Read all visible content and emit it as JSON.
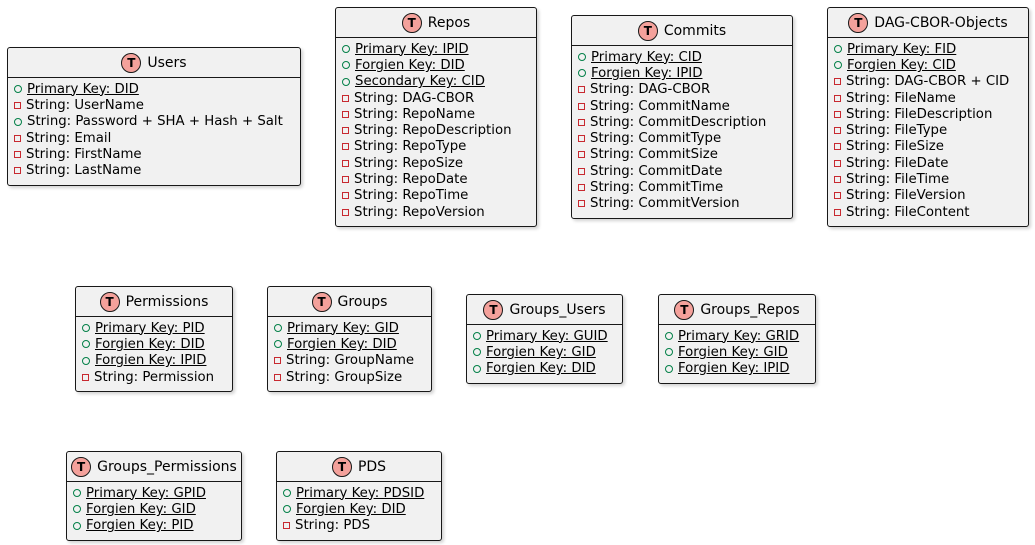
{
  "badge_letter": "T",
  "colors": {
    "badge_fill": "#f4a19b",
    "public": "#038048",
    "private": "#c82930",
    "box_fill": "#f1f1f1",
    "border": "#181818"
  },
  "entities": [
    {
      "id": "users",
      "title": "Users",
      "rows": [
        {
          "text": "Primary Key: DID",
          "vis": "public",
          "underline": true
        },
        {
          "text": "String: UserName",
          "vis": "private",
          "underline": false
        },
        {
          "text": "String: Password + SHA + Hash + Salt",
          "vis": "public",
          "underline": false
        },
        {
          "text": "String: Email",
          "vis": "private",
          "underline": false
        },
        {
          "text": "String: FirstName",
          "vis": "private",
          "underline": false
        },
        {
          "text": "String: LastName",
          "vis": "private",
          "underline": false
        }
      ]
    },
    {
      "id": "repos",
      "title": "Repos",
      "rows": [
        {
          "text": "Primary Key: IPID",
          "vis": "public",
          "underline": true
        },
        {
          "text": "Forgien Key: DID",
          "vis": "public",
          "underline": true
        },
        {
          "text": "Secondary Key: CID ",
          "vis": "public",
          "underline": true
        },
        {
          "text": "String: DAG-CBOR",
          "vis": "private",
          "underline": false
        },
        {
          "text": "String: RepoName",
          "vis": "private",
          "underline": false
        },
        {
          "text": "String: RepoDescription",
          "vis": "private",
          "underline": false
        },
        {
          "text": "String: RepoType",
          "vis": "private",
          "underline": false
        },
        {
          "text": "String: RepoSize",
          "vis": "private",
          "underline": false
        },
        {
          "text": "String: RepoDate",
          "vis": "private",
          "underline": false
        },
        {
          "text": "String: RepoTime",
          "vis": "private",
          "underline": false
        },
        {
          "text": "String: RepoVersion",
          "vis": "private",
          "underline": false
        }
      ]
    },
    {
      "id": "commits",
      "title": "Commits",
      "rows": [
        {
          "text": "Primary Key: CID",
          "vis": "public",
          "underline": true
        },
        {
          "text": "Forgien Key: IPID",
          "vis": "public",
          "underline": true
        },
        {
          "text": "String: DAG-CBOR",
          "vis": "private",
          "underline": false
        },
        {
          "text": "String: CommitName",
          "vis": "private",
          "underline": false
        },
        {
          "text": "String: CommitDescription",
          "vis": "private",
          "underline": false
        },
        {
          "text": "String: CommitType",
          "vis": "private",
          "underline": false
        },
        {
          "text": "String: CommitSize",
          "vis": "private",
          "underline": false
        },
        {
          "text": "String: CommitDate",
          "vis": "private",
          "underline": false
        },
        {
          "text": "String: CommitTime",
          "vis": "private",
          "underline": false
        },
        {
          "text": "String: CommitVersion",
          "vis": "private",
          "underline": false
        }
      ]
    },
    {
      "id": "dagcbor",
      "title": "DAG-CBOR-Objects",
      "rows": [
        {
          "text": "Primary Key: FID",
          "vis": "public",
          "underline": true
        },
        {
          "text": "Forgien Key: CID",
          "vis": "public",
          "underline": true
        },
        {
          "text": "String: DAG-CBOR + CID",
          "vis": "private",
          "underline": false
        },
        {
          "text": "String: FileName",
          "vis": "private",
          "underline": false
        },
        {
          "text": "String: FileDescription",
          "vis": "private",
          "underline": false
        },
        {
          "text": "String: FileType",
          "vis": "private",
          "underline": false
        },
        {
          "text": "String: FileSize",
          "vis": "private",
          "underline": false
        },
        {
          "text": "String: FileDate",
          "vis": "private",
          "underline": false
        },
        {
          "text": "String: FileTime",
          "vis": "private",
          "underline": false
        },
        {
          "text": "String: FileVersion",
          "vis": "private",
          "underline": false
        },
        {
          "text": "String: FileContent",
          "vis": "private",
          "underline": false
        }
      ]
    },
    {
      "id": "permissions",
      "title": "Permissions",
      "rows": [
        {
          "text": "Primary Key: PID",
          "vis": "public",
          "underline": true
        },
        {
          "text": "Forgien Key: DID",
          "vis": "public",
          "underline": true
        },
        {
          "text": "Forgien Key: IPID",
          "vis": "public",
          "underline": true
        },
        {
          "text": "String: Permission",
          "vis": "private",
          "underline": false
        }
      ]
    },
    {
      "id": "groups",
      "title": "Groups",
      "rows": [
        {
          "text": "Primary Key: GID",
          "vis": "public",
          "underline": true
        },
        {
          "text": "Forgien Key: DID",
          "vis": "public",
          "underline": true
        },
        {
          "text": "String: GroupName",
          "vis": "private",
          "underline": false
        },
        {
          "text": "String: GroupSize",
          "vis": "private",
          "underline": false
        }
      ]
    },
    {
      "id": "groups_users",
      "title": "Groups_Users",
      "rows": [
        {
          "text": "Primary Key: GUID",
          "vis": "public",
          "underline": true
        },
        {
          "text": "Forgien Key: GID",
          "vis": "public",
          "underline": true
        },
        {
          "text": "Forgien Key: DID",
          "vis": "public",
          "underline": true
        }
      ]
    },
    {
      "id": "groups_repos",
      "title": "Groups_Repos",
      "rows": [
        {
          "text": "Primary Key: GRID",
          "vis": "public",
          "underline": true
        },
        {
          "text": "Forgien Key: GID",
          "vis": "public",
          "underline": true
        },
        {
          "text": "Forgien Key: IPID",
          "vis": "public",
          "underline": true
        }
      ]
    },
    {
      "id": "groups_permissions",
      "title": "Groups_Permissions",
      "rows": [
        {
          "text": "Primary Key: GPID",
          "vis": "public",
          "underline": true
        },
        {
          "text": "Forgien Key: GID",
          "vis": "public",
          "underline": true
        },
        {
          "text": "Forgien Key: PID",
          "vis": "public",
          "underline": true
        }
      ]
    },
    {
      "id": "pds",
      "title": "PDS",
      "rows": [
        {
          "text": "Primary Key: PDSID",
          "vis": "public",
          "underline": true
        },
        {
          "text": "Forgien Key: DID",
          "vis": "public",
          "underline": true
        },
        {
          "text": "String: PDS",
          "vis": "private",
          "underline": false
        }
      ]
    }
  ]
}
